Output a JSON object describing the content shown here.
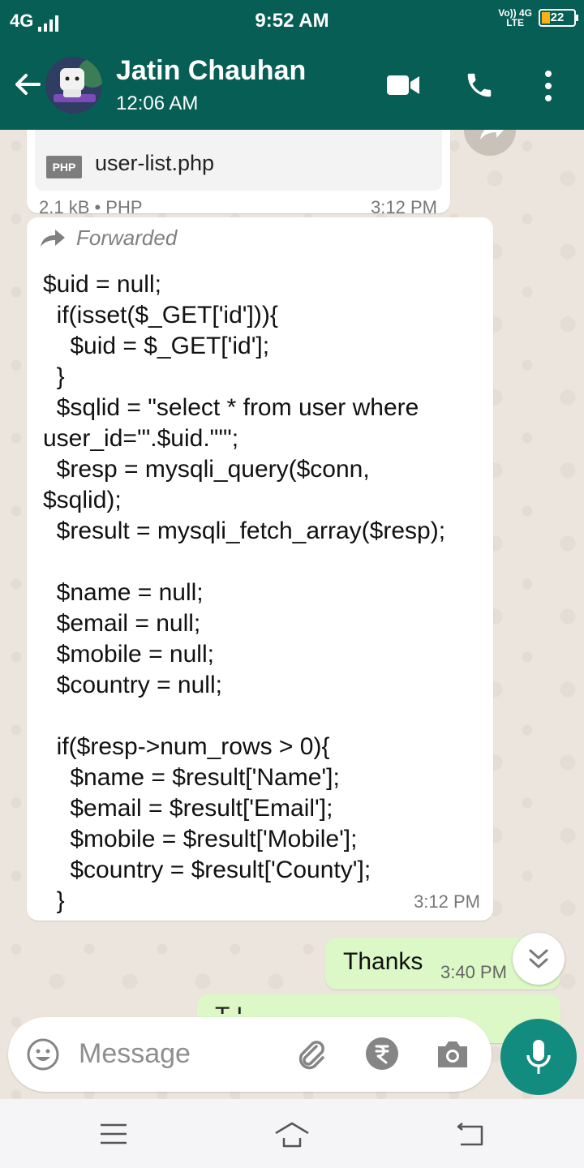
{
  "status_bar": {
    "network": "4G",
    "time": "9:52 AM",
    "volte": "Vo)) 4G",
    "lte": "LTE",
    "battery": "22"
  },
  "header": {
    "contact_name": "Jatin Chauhan",
    "last_seen": "12:06 AM",
    "icons": [
      "back-arrow-icon",
      "video-call-icon",
      "voice-call-icon",
      "more-options-icon"
    ],
    "theme_color": "#075e54"
  },
  "messages": {
    "document": {
      "icon_label": "PHP",
      "file_name": "user-list.php",
      "meta": "2.1 kB • PHP",
      "time": "3:12 PM"
    },
    "code_message": {
      "forwarded_label": "Forwarded",
      "lines": [
        "$uid = null;",
        "  if(isset($_GET['id'])){",
        "    $uid = $_GET['id'];",
        "  }",
        "  $sqlid = \"select * from user where",
        "user_id='\".$uid.\"'\";",
        "  $resp = mysqli_query($conn,",
        "$sqlid);",
        "  $result = mysqli_fetch_array($resp);",
        "",
        "  $name = null;",
        "  $email = null;",
        "  $mobile = null;",
        "  $country = null;",
        "",
        "  if($resp->num_rows > 0){",
        "    $name = $result['Name'];",
        "    $email = $result['Email'];",
        "    $mobile = $result['Mobile'];",
        "    $country = $result['County'];",
        "  }"
      ],
      "time": "3:12 PM"
    },
    "outgoing": {
      "text": "Thanks",
      "time": "3:40 PM"
    },
    "outgoing_partial": {
      "text": "T    I       "
    }
  },
  "input": {
    "placeholder": "Message",
    "icons": [
      "emoji-icon",
      "attach-icon",
      "rupee-payment-icon",
      "camera-icon",
      "mic-icon"
    ],
    "mic_color": "#128c7e"
  },
  "nav": {
    "icons": [
      "menu-icon",
      "home-icon",
      "back-icon"
    ]
  }
}
